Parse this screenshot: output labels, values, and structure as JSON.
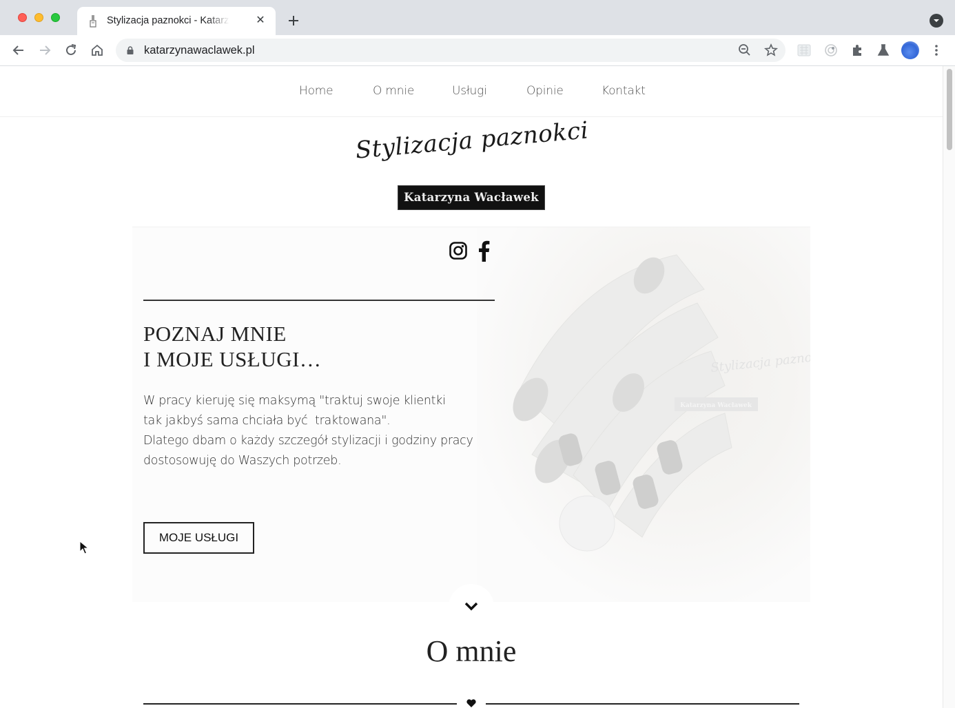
{
  "browser": {
    "tab_title": "Stylizacja paznokci - Katarzyna Wacławek",
    "url": "katarzynawaclawek.pl"
  },
  "nav": {
    "items": [
      "Home",
      "O mnie",
      "Usługi",
      "Opinie",
      "Kontakt"
    ]
  },
  "logo": {
    "script_text": "Stylizacja paznokci",
    "name_box": "Katarzyna Wacławek"
  },
  "hero": {
    "heading_line1": "POZNAJ MNIE",
    "heading_line2": "I MOJE USŁUGI…",
    "text_line1": "W pracy kieruję się maksymą \"traktuj swoje klientki",
    "text_line2": "tak jakbyś sama chciała być  traktowana\".",
    "text_line3": "Dlatego dbam o każdy szczegół stylizacji i godziny pracy",
    "text_line4": "dostosowuję do Waszych potrzeb.",
    "button": "MOJE USŁUGI",
    "watermark_script": "Stylizacja paznokci",
    "watermark_box": "Katarzyna Wacławek"
  },
  "about": {
    "title": "O mnie"
  },
  "icons": {
    "social": [
      "instagram-icon",
      "facebook-icon"
    ],
    "scroll": "chevron-down-icon",
    "divider": "heart-icon"
  }
}
